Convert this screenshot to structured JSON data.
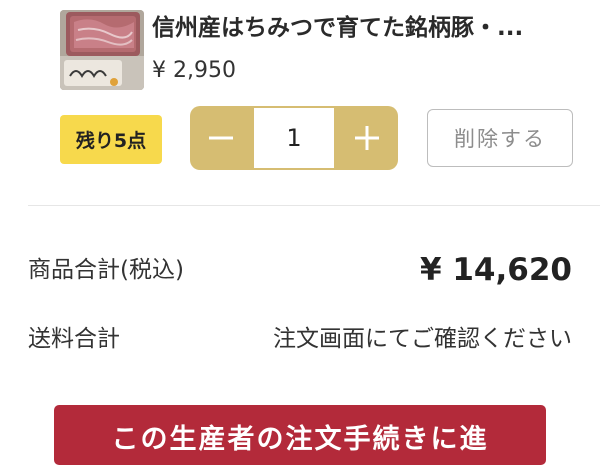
{
  "cart_item": {
    "image_icon": "meat-package-photo",
    "title": "信州産はちみつで育てた銘柄豚・...",
    "price": "¥ 2,950",
    "stock_badge": "残り5点",
    "quantity": "1",
    "decrement_icon": "minus-icon",
    "increment_icon": "plus-icon",
    "delete_label": "削除する"
  },
  "summary": {
    "subtotal_label": "商品合計(税込)",
    "subtotal_value": "¥ 14,620",
    "shipping_label": "送料合計",
    "shipping_value": "注文画面にてご確認ください"
  },
  "checkout": {
    "label": "この生産者の注文手続きに進"
  },
  "colors": {
    "stepper_gold": "#d6bd72",
    "stock_badge_yellow": "#f7d94c",
    "checkout_red": "#b32a3a",
    "delete_border_gray": "#bdbdbd"
  }
}
